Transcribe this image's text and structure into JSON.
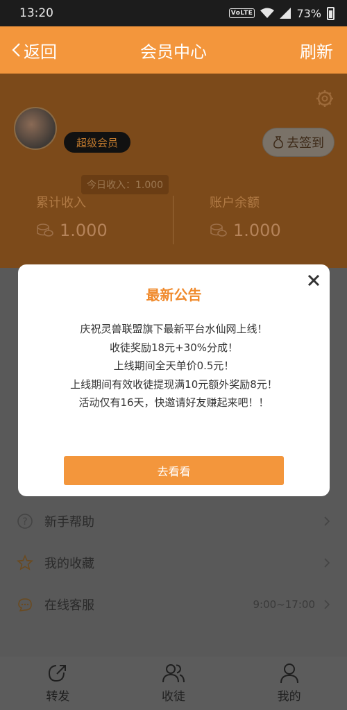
{
  "status_bar": {
    "time": "13:20",
    "volte": "VoLTE",
    "battery": "73%"
  },
  "header": {
    "back": "返回",
    "title": "会员中心",
    "refresh": "刷新"
  },
  "profile": {
    "vip_badge": "超级会员",
    "signin_label": "去签到",
    "today_income": "今日收入：1.000",
    "stats": [
      {
        "label": "累计收入",
        "value": "1.000"
      },
      {
        "label": "账户余额",
        "value": "1.000"
      }
    ]
  },
  "menu": [
    {
      "label": "新手帮助",
      "icon": "question-icon",
      "hours": ""
    },
    {
      "label": "我的收藏",
      "icon": "star-icon",
      "hours": ""
    },
    {
      "label": "在线客服",
      "icon": "chat-icon",
      "hours": "9:00~17:00"
    }
  ],
  "bottom_nav": [
    {
      "label": "转发",
      "icon": "share-icon"
    },
    {
      "label": "收徒",
      "icon": "users-icon"
    },
    {
      "label": "我的",
      "icon": "user-icon"
    }
  ],
  "modal": {
    "title": "最新公告",
    "lines": [
      "庆祝灵兽联盟旗下最新平台水仙网上线！",
      "收徒奖励18元+30%分成！",
      "上线期间全天单价0.5元！",
      "上线期间有效收徒提现满10元额外奖励8元！",
      "活动仅有16天，快邀请好友赚起来吧！！"
    ],
    "button": "去看看"
  },
  "colors": {
    "accent": "#f3963c",
    "title_orange": "#f08a2c"
  }
}
